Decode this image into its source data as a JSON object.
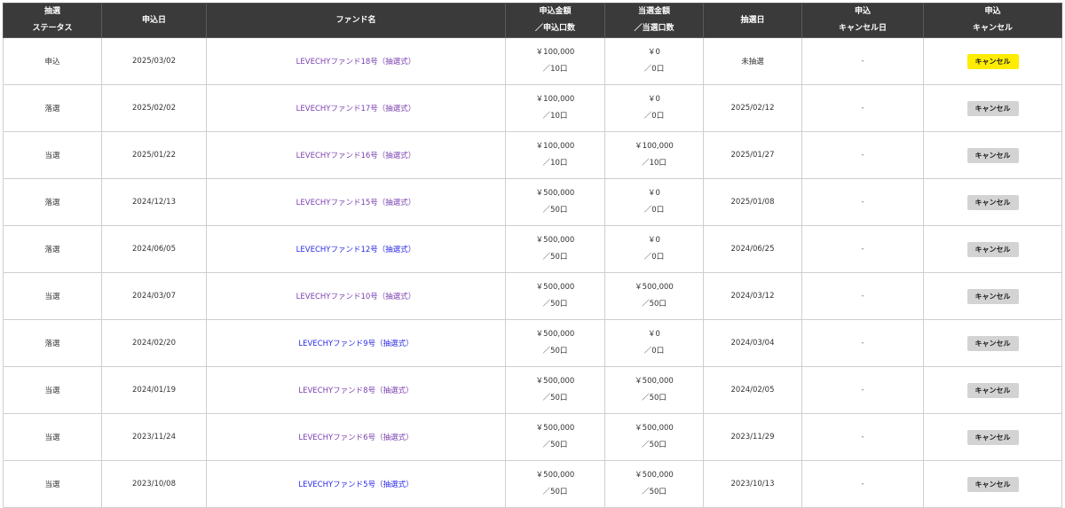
{
  "header": {
    "status": [
      "抽選",
      "ステータス"
    ],
    "apply_date": "申込日",
    "fund_name": "ファンド名",
    "apply_amount": [
      "申込金額",
      "／申込口数"
    ],
    "won_amount": [
      "当選金額",
      "／当選口数"
    ],
    "draw_date": "抽選日",
    "cancel_date": [
      "申込",
      "キャンセル日"
    ],
    "cancel": [
      "申込",
      "キャンセル"
    ]
  },
  "rows": [
    {
      "status": "申込",
      "apply_date": "2025/03/02",
      "fund": "LEVECHYファンド18号（抽選式）",
      "fund_color": "#7a3fb0",
      "apply_amount": "￥100,000",
      "apply_units": "／10口",
      "won_amount": "￥0",
      "won_units": "／0口",
      "draw_date": "未抽選",
      "cancel_date": "-",
      "cancel_label": "キャンセル",
      "cancel_active": true
    },
    {
      "status": "落選",
      "apply_date": "2025/02/02",
      "fund": "LEVECHYファンド17号（抽選式）",
      "fund_color": "#7a3fb0",
      "apply_amount": "￥100,000",
      "apply_units": "／10口",
      "won_amount": "￥0",
      "won_units": "／0口",
      "draw_date": "2025/02/12",
      "cancel_date": "-",
      "cancel_label": "キャンセル",
      "cancel_active": false
    },
    {
      "status": "当選",
      "apply_date": "2025/01/22",
      "fund": "LEVECHYファンド16号（抽選式）",
      "fund_color": "#7a3fb0",
      "apply_amount": "￥100,000",
      "apply_units": "／10口",
      "won_amount": "￥100,000",
      "won_units": "／10口",
      "draw_date": "2025/01/27",
      "cancel_date": "-",
      "cancel_label": "キャンセル",
      "cancel_active": false
    },
    {
      "status": "落選",
      "apply_date": "2024/12/13",
      "fund": "LEVECHYファンド15号（抽選式）",
      "fund_color": "#7a3fb0",
      "apply_amount": "￥500,000",
      "apply_units": "／50口",
      "won_amount": "￥0",
      "won_units": "／0口",
      "draw_date": "2025/01/08",
      "cancel_date": "-",
      "cancel_label": "キャンセル",
      "cancel_active": false
    },
    {
      "status": "落選",
      "apply_date": "2024/06/05",
      "fund": "LEVECHYファンド12号（抽選式）",
      "fund_color": "#2a2ae8",
      "apply_amount": "￥500,000",
      "apply_units": "／50口",
      "won_amount": "￥0",
      "won_units": "／0口",
      "draw_date": "2024/06/25",
      "cancel_date": "-",
      "cancel_label": "キャンセル",
      "cancel_active": false
    },
    {
      "status": "当選",
      "apply_date": "2024/03/07",
      "fund": "LEVECHYファンド10号（抽選式）",
      "fund_color": "#7a3fb0",
      "apply_amount": "￥500,000",
      "apply_units": "／50口",
      "won_amount": "￥500,000",
      "won_units": "／50口",
      "draw_date": "2024/03/12",
      "cancel_date": "-",
      "cancel_label": "キャンセル",
      "cancel_active": false
    },
    {
      "status": "落選",
      "apply_date": "2024/02/20",
      "fund": "LEVECHYファンド9号（抽選式）",
      "fund_color": "#2a2ae8",
      "apply_amount": "￥500,000",
      "apply_units": "／50口",
      "won_amount": "￥0",
      "won_units": "／0口",
      "draw_date": "2024/03/04",
      "cancel_date": "-",
      "cancel_label": "キャンセル",
      "cancel_active": false
    },
    {
      "status": "当選",
      "apply_date": "2024/01/19",
      "fund": "LEVECHYファンド8号（抽選式）",
      "fund_color": "#7a3fb0",
      "apply_amount": "￥500,000",
      "apply_units": "／50口",
      "won_amount": "￥500,000",
      "won_units": "／50口",
      "draw_date": "2024/02/05",
      "cancel_date": "-",
      "cancel_label": "キャンセル",
      "cancel_active": false
    },
    {
      "status": "当選",
      "apply_date": "2023/11/24",
      "fund": "LEVECHYファンド6号（抽選式）",
      "fund_color": "#7a3fb0",
      "apply_amount": "￥500,000",
      "apply_units": "／50口",
      "won_amount": "￥500,000",
      "won_units": "／50口",
      "draw_date": "2023/11/29",
      "cancel_date": "-",
      "cancel_label": "キャンセル",
      "cancel_active": false
    },
    {
      "status": "当選",
      "apply_date": "2023/10/08",
      "fund": "LEVECHYファンド5号（抽選式）",
      "fund_color": "#2a2ae8",
      "apply_amount": "￥500,000",
      "apply_units": "／50口",
      "won_amount": "￥500,000",
      "won_units": "／50口",
      "draw_date": "2023/10/13",
      "cancel_date": "-",
      "cancel_label": "キャンセル",
      "cancel_active": false
    }
  ]
}
